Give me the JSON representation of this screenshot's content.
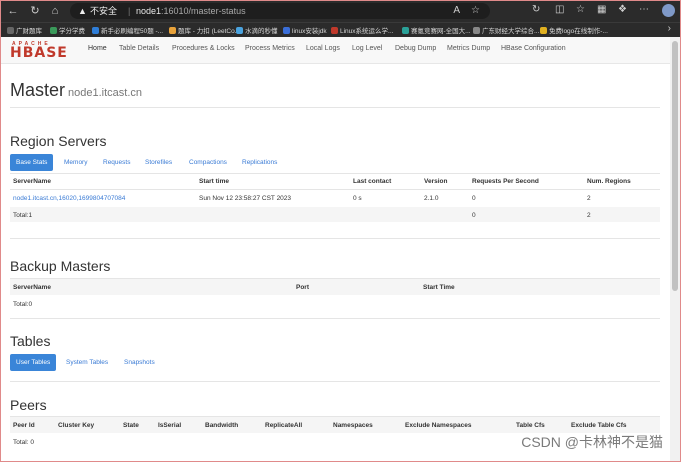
{
  "browser": {
    "insecure_label": "不安全",
    "url_host": "node1",
    "url_rest": ":16010/master-status",
    "bookmarks": [
      {
        "label": "广财题库",
        "color": "#666666"
      },
      {
        "label": "学分学费",
        "color": "#3a9a5a"
      },
      {
        "label": "新手必刷编程50题 -...",
        "color": "#2f7ed8"
      },
      {
        "label": "题库 - 力扣 (LeetCo...",
        "color": "#e8a23a"
      },
      {
        "label": "水滴的秒懂",
        "color": "#4aa3df"
      },
      {
        "label": "linux安装jdk",
        "color": "#3a6ed8"
      },
      {
        "label": "Linux系统运么学...",
        "color": "#c0392b"
      },
      {
        "label": "赛氪竞赛网-全国大...",
        "color": "#2aa198"
      },
      {
        "label": "广东财经大学综合...",
        "color": "#888888"
      },
      {
        "label": "免费logo在线制作-...",
        "color": "#e0b020"
      }
    ]
  },
  "nav": {
    "items": [
      "Home",
      "Table Details",
      "Procedures & Locks",
      "Process Metrics",
      "Local Logs",
      "Log Level",
      "Debug Dump",
      "Metrics Dump",
      "HBase Configuration"
    ]
  },
  "page": {
    "title": "Master",
    "subtitle": "node1.itcast.cn"
  },
  "region_servers": {
    "heading": "Region Servers",
    "tabs": [
      "Base Stats",
      "Memory",
      "Requests",
      "Storefiles",
      "Compactions",
      "Replications"
    ],
    "columns": [
      "ServerName",
      "Start time",
      "Last contact",
      "Version",
      "Requests Per Second",
      "Num. Regions"
    ],
    "rows": [
      [
        "node1.itcast.cn,16020,1699804707084",
        "Sun Nov 12 23:58:27 CST 2023",
        "0 s",
        "2.1.0",
        "0",
        "2"
      ]
    ],
    "total": [
      "Total:1",
      "",
      "",
      "",
      "0",
      "2"
    ]
  },
  "backup_masters": {
    "heading": "Backup Masters",
    "columns": [
      "ServerName",
      "Port",
      "Start Time"
    ],
    "total": "Total:0"
  },
  "tables": {
    "heading": "Tables",
    "tabs": [
      "User Tables",
      "System Tables",
      "Snapshots"
    ]
  },
  "peers": {
    "heading": "Peers",
    "columns": [
      "Peer Id",
      "Cluster Key",
      "State",
      "IsSerial",
      "Bandwidth",
      "ReplicateAll",
      "Namespaces",
      "Exclude Namespaces",
      "Table Cfs",
      "Exclude Table Cfs"
    ],
    "total": "Total: 0"
  },
  "watermark": "CSDN @卡林神不是猫"
}
